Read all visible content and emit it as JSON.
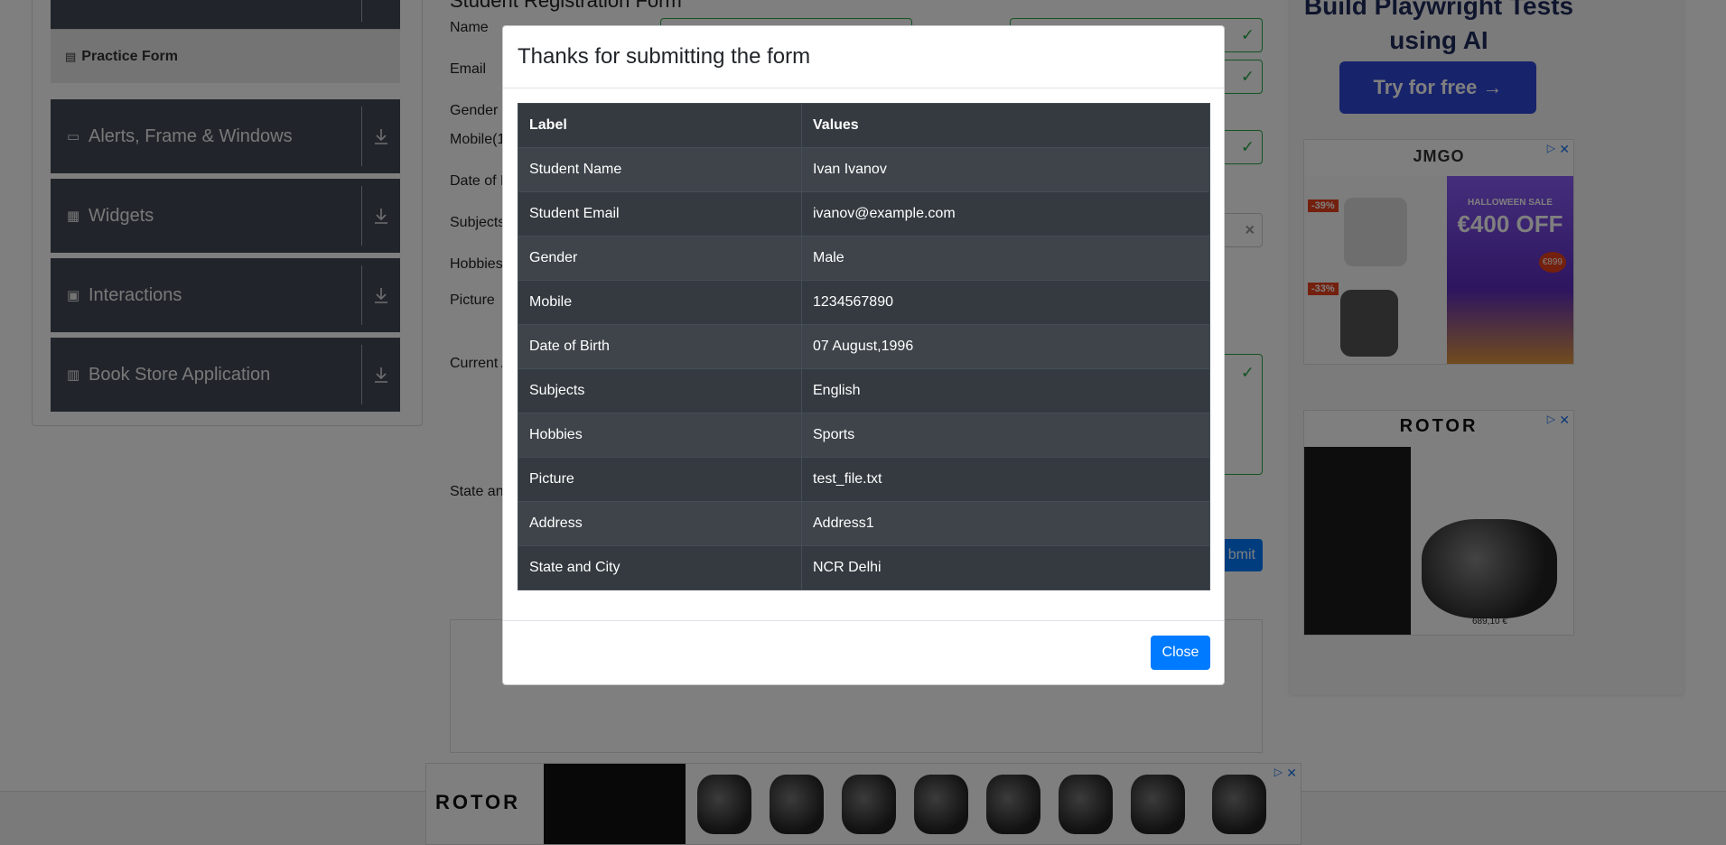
{
  "sidebar": {
    "practice_form_label": "Practice Form",
    "items": [
      {
        "label": "Alerts, Frame & Windows",
        "icon": "window-icon"
      },
      {
        "label": "Widgets",
        "icon": "widgets-icon"
      },
      {
        "label": "Interactions",
        "icon": "interactions-icon"
      },
      {
        "label": "Book Store Application",
        "icon": "books-icon"
      }
    ]
  },
  "form": {
    "title": "Student Registration Form",
    "labels": {
      "name": "Name",
      "email": "Email",
      "gender": "Gender",
      "mobile": "Mobile(1",
      "dob": "Date of B",
      "subjects": "Subjects",
      "hobbies": "Hobbies",
      "picture": "Picture",
      "current_address": "Current A",
      "state_city": "State an"
    },
    "submit_label": "bmit"
  },
  "ads": {
    "headline": "Build Playwright Tests using AI",
    "try_button": "Try for free →",
    "jmgo_brand": "JMGO",
    "jmgo_sale": "HALLOWEEN SALE",
    "jmgo_offer": "€400 OFF",
    "jmgo_badge1": "-39%",
    "jmgo_badge2": "-33%",
    "jmgo_price": "€899",
    "rotor_brand": "ROTOR",
    "rotor_price": "689,10 €"
  },
  "modal": {
    "title": "Thanks for submitting the form",
    "table": {
      "headers": [
        "Label",
        "Values"
      ],
      "rows": [
        [
          "Student Name",
          "Ivan Ivanov"
        ],
        [
          "Student Email",
          "ivanov@example.com"
        ],
        [
          "Gender",
          "Male"
        ],
        [
          "Mobile",
          "1234567890"
        ],
        [
          "Date of Birth",
          "07 August,1996"
        ],
        [
          "Subjects",
          "English"
        ],
        [
          "Hobbies",
          "Sports"
        ],
        [
          "Picture",
          "test_file.txt"
        ],
        [
          "Address",
          "Address1"
        ],
        [
          "State and City",
          "NCR Delhi"
        ]
      ]
    },
    "close_label": "Close"
  },
  "colors": {
    "accent": "#007bff",
    "table_dark": "#343a40",
    "table_stripe": "#3e444a",
    "valid_green": "#28a745"
  }
}
